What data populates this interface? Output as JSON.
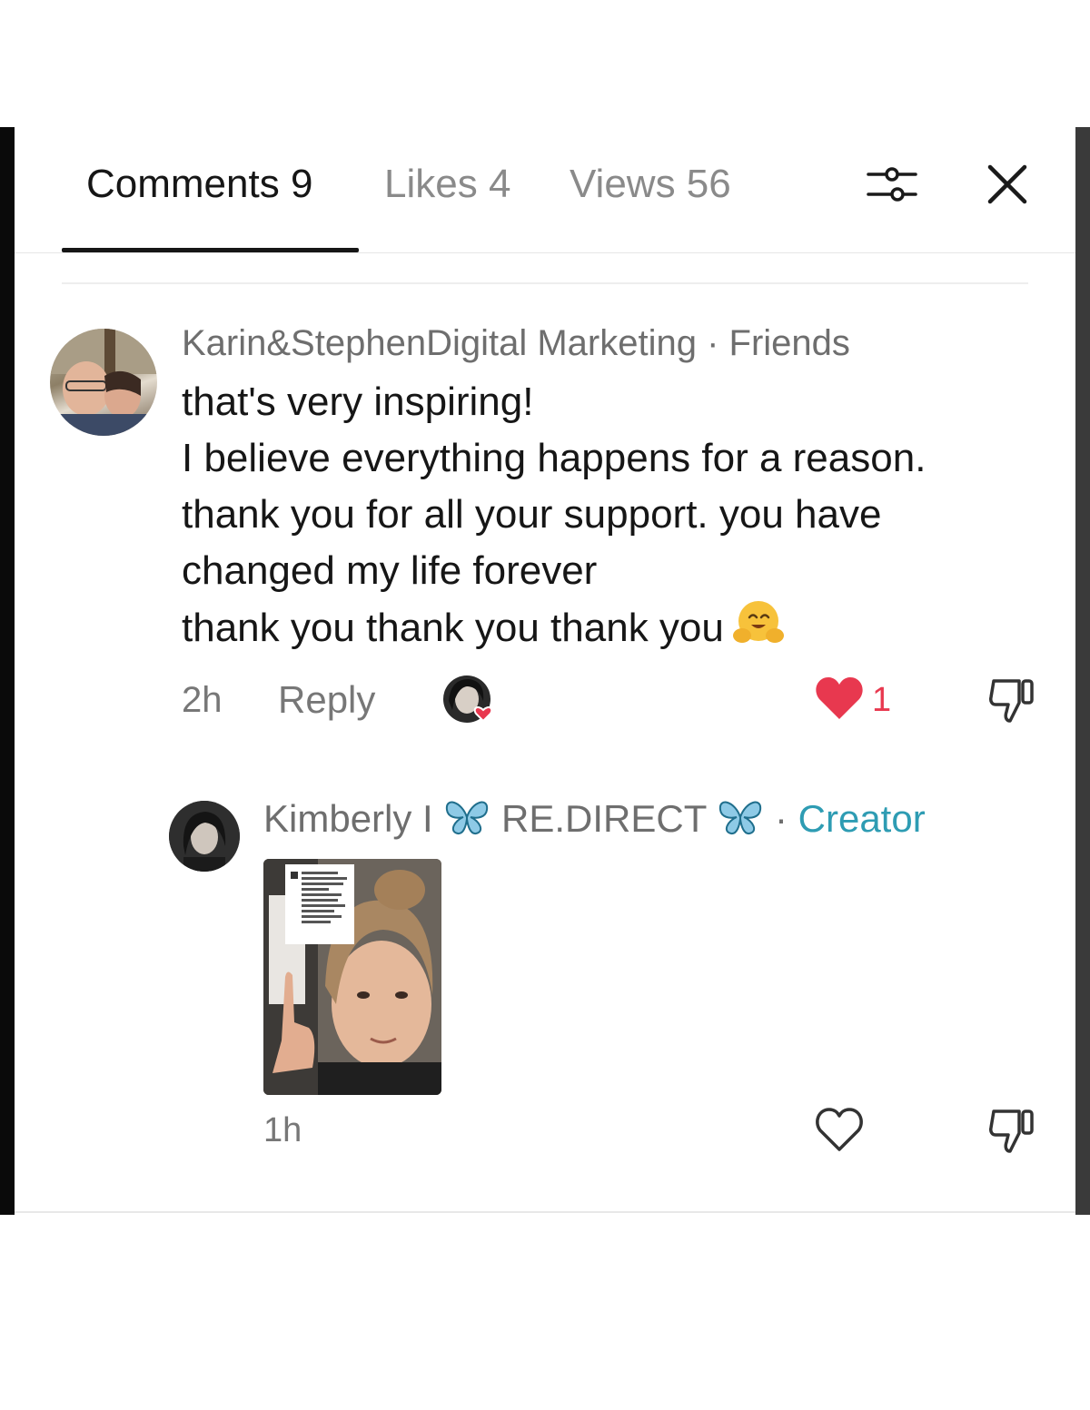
{
  "tabs": {
    "comments": "Comments 9",
    "likes": "Likes 4",
    "views": "Views 56"
  },
  "icons": {
    "filter": "sliders-icon",
    "close": "close-icon"
  },
  "comment1": {
    "author": "Karin&StephenDigital Marketing",
    "relation": " · Friends",
    "lines": [
      "that's very inspiring!",
      "I believe everything happens for a reason.",
      "thank you for all your support. you have",
      "changed my life forever",
      "thank you thank you thank you"
    ],
    "emoji": "hugging-face-emoji",
    "time": "2h",
    "reply_label": "Reply",
    "like_count": "1",
    "liked": true
  },
  "comment2": {
    "author": "Kimberly I",
    "author_suffix": "RE.DIRECT",
    "separator": " · ",
    "role": "Creator",
    "time": "1h",
    "liked": false
  },
  "colors": {
    "like_red": "#e8384f",
    "creator_teal": "#2e9cb3",
    "butterfly_blue": "#8ecae6"
  }
}
